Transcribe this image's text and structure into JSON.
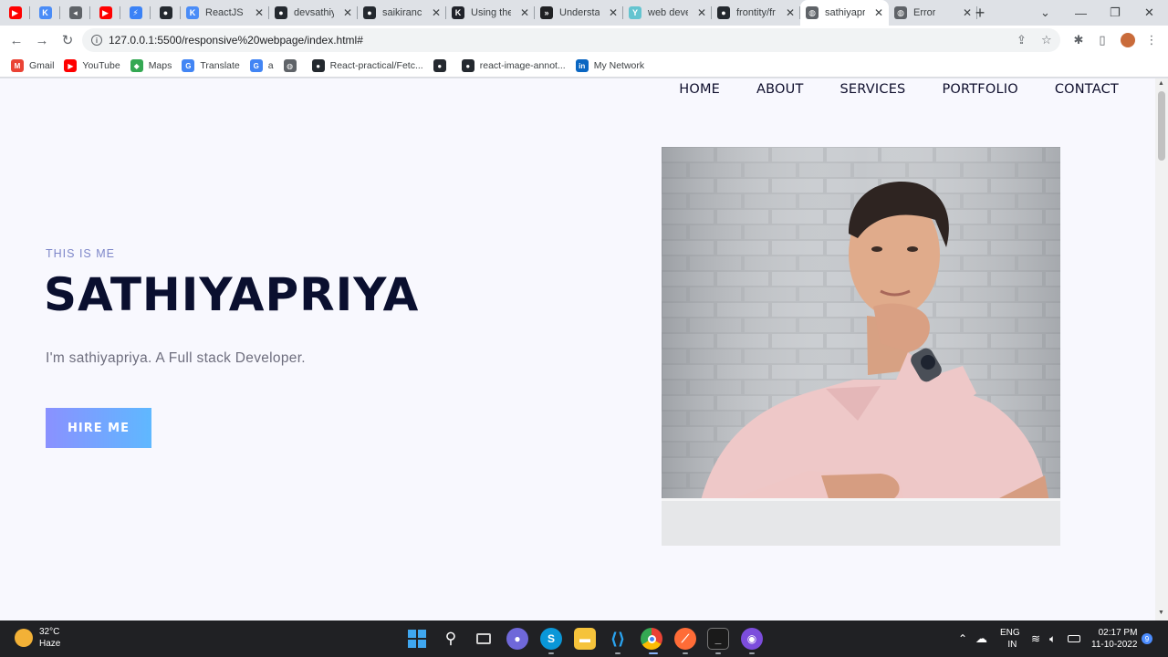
{
  "browser": {
    "tabs": [
      {
        "title": "",
        "favicon": "youtube-icon",
        "color": "#ff0000"
      },
      {
        "title": "",
        "favicon": "react-icon",
        "color": "#4a8cf7"
      },
      {
        "title": "",
        "favicon": "audio-icon",
        "color": "#5f6368"
      },
      {
        "title": "",
        "favicon": "youtube-icon",
        "color": "#ff0000"
      },
      {
        "title": "",
        "favicon": "bolt-icon",
        "color": "#3b82f6"
      },
      {
        "title": "",
        "favicon": "github-icon",
        "color": "#24292f"
      },
      {
        "title": "ReactJS D",
        "favicon": "react-icon",
        "color": "#4a8cf7"
      },
      {
        "title": "devsathiy",
        "favicon": "github-icon",
        "color": "#24292f"
      },
      {
        "title": "saikiranck",
        "favicon": "github-icon",
        "color": "#24292f"
      },
      {
        "title": "Using the",
        "favicon": "react-icon",
        "color": "#20232a"
      },
      {
        "title": "Understa",
        "favicon": "chevrons-icon",
        "color": "#202124"
      },
      {
        "title": "web deve",
        "favicon": "fork-icon",
        "color": "#64c4d0"
      },
      {
        "title": "frontity/fr",
        "favicon": "github-icon",
        "color": "#24292f"
      },
      {
        "title": "sathiyapr",
        "favicon": "globe-icon",
        "color": "#5f6368",
        "active": true
      },
      {
        "title": "Error",
        "favicon": "globe-icon",
        "color": "#5f6368"
      }
    ],
    "url": "127.0.0.1:5500/responsive%20webpage/index.html#",
    "bookmarks": [
      {
        "label": "Gmail",
        "icon": "gmail-icon",
        "color": "#ea4335"
      },
      {
        "label": "YouTube",
        "icon": "youtube-icon",
        "color": "#ff0000"
      },
      {
        "label": "Maps",
        "icon": "maps-icon",
        "color": "#34a853"
      },
      {
        "label": "Translate",
        "icon": "translate-icon",
        "color": "#4285f4"
      },
      {
        "label": "a",
        "icon": "google-icon",
        "color": "#4285f4"
      },
      {
        "label": "",
        "icon": "globe-icon",
        "color": "#5f6368"
      },
      {
        "label": "React-practical/Fetc...",
        "icon": "github-icon",
        "color": "#24292f"
      },
      {
        "label": "",
        "icon": "github-icon",
        "color": "#24292f"
      },
      {
        "label": "react-image-annot...",
        "icon": "github-icon",
        "color": "#24292f"
      },
      {
        "label": "My Network",
        "icon": "linkedin-icon",
        "color": "#0a66c2"
      }
    ]
  },
  "page": {
    "nav": [
      "HOME",
      "ABOUT",
      "SERVICES",
      "PORTFOLIO",
      "CONTACT"
    ],
    "eyebrow": "THIS IS ME",
    "name": "SATHIYAPRIYA",
    "tagline": "I'm sathiyapriya. A Full stack Developer.",
    "cta": "HIRE ME"
  },
  "taskbar": {
    "temp": "32°C",
    "weather": "Haze",
    "lang": "ENG",
    "region": "IN",
    "time": "02:17 PM",
    "date": "11-10-2022",
    "notifications": "9"
  }
}
